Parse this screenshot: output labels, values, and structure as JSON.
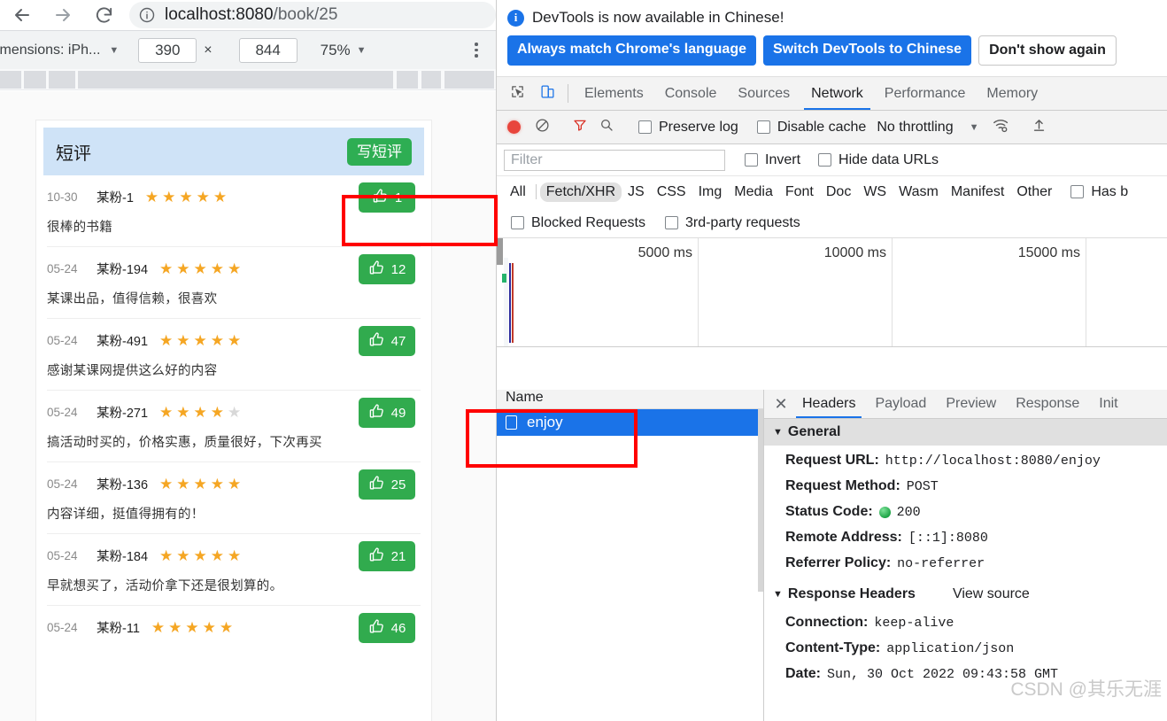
{
  "browser": {
    "back_label": "back-arrow",
    "forward_label": "forward-arrow",
    "reload_label": "reload",
    "site_info_label": "site-information",
    "url_host": "localhost:8080",
    "url_path": "/book/25"
  },
  "device_toolbar": {
    "device_label": "imensions: iPh...",
    "width": "390",
    "times": "×",
    "height": "844",
    "zoom": "75%",
    "caret": "▼",
    "more_label": "more-options"
  },
  "page": {
    "section_title": "短评",
    "write_button": "写短评",
    "comments": [
      {
        "date": "10-30",
        "user": "某粉-1",
        "stars": 5,
        "text": "很棒的书籍",
        "likes": "1"
      },
      {
        "date": "05-24",
        "user": "某粉-194",
        "stars": 5,
        "text": "某课出品，值得信赖，很喜欢",
        "likes": "12"
      },
      {
        "date": "05-24",
        "user": "某粉-491",
        "stars": 5,
        "text": "感谢某课网提供这么好的内容",
        "likes": "47"
      },
      {
        "date": "05-24",
        "user": "某粉-271",
        "stars": 4,
        "text": "搞活动时买的，价格实惠，质量很好，下次再买",
        "likes": "49"
      },
      {
        "date": "05-24",
        "user": "某粉-136",
        "stars": 5,
        "text": "内容详细，挺值得拥有的！",
        "likes": "25"
      },
      {
        "date": "05-24",
        "user": "某粉-184",
        "stars": 5,
        "text": "早就想买了，活动价拿下还是很划算的。",
        "likes": "21"
      },
      {
        "date": "05-24",
        "user": "某粉-11",
        "stars": 5,
        "text": "",
        "likes": "46"
      }
    ],
    "star_on": "★",
    "star_off": "★",
    "thumb_icon": "👍"
  },
  "devtools": {
    "banner": {
      "message": "DevTools is now available in Chinese!",
      "btn_always": "Always match Chrome's language",
      "btn_switch": "Switch DevTools to Chinese",
      "btn_dismiss": "Don't show again"
    },
    "panel_tabs": [
      "Elements",
      "Console",
      "Sources",
      "Network",
      "Performance",
      "Memory"
    ],
    "selected_panel": "Network",
    "toolbar": {
      "record_label": "record",
      "clear_label": "clear",
      "filter_label": "filter",
      "search_label": "search",
      "preserve_log": "Preserve log",
      "disable_cache": "Disable cache",
      "throttling": "No throttling",
      "caret": "▼",
      "wifi_label": "network-conditions",
      "import_label": "import-har"
    },
    "filterbar": {
      "placeholder": "Filter",
      "invert": "Invert",
      "hide_data_urls": "Hide data URLs"
    },
    "types": [
      "All",
      "Fetch/XHR",
      "JS",
      "CSS",
      "Img",
      "Media",
      "Font",
      "Doc",
      "WS",
      "Wasm",
      "Manifest",
      "Other"
    ],
    "selected_type": "Fetch/XHR",
    "has_blocked": "Has b",
    "blocked_requests": "Blocked Requests",
    "third_party": "3rd-party requests",
    "overview": {
      "ticks": [
        "5000 ms",
        "10000 ms",
        "15000 ms"
      ]
    },
    "requests": {
      "column_name": "Name",
      "rows": [
        {
          "name": "enjoy"
        }
      ]
    },
    "detail": {
      "close": "✕",
      "tabs": [
        "Headers",
        "Payload",
        "Preview",
        "Response",
        "Init"
      ],
      "selected_tab": "Headers",
      "general_title": "General",
      "general": [
        {
          "key": "Request URL:",
          "value": "http://localhost:8080/enjoy"
        },
        {
          "key": "Request Method:",
          "value": "POST"
        },
        {
          "key": "Status Code:",
          "value": "200",
          "status_dot": true
        },
        {
          "key": "Remote Address:",
          "value": "[::1]:8080"
        },
        {
          "key": "Referrer Policy:",
          "value": "no-referrer"
        }
      ],
      "response_title": "Response Headers",
      "view_source": "View source",
      "response": [
        {
          "key": "Connection:",
          "value": "keep-alive"
        },
        {
          "key": "Content-Type:",
          "value": "application/json"
        },
        {
          "key": "Date:",
          "value": "Sun, 30 Oct 2022 09:43:58 GMT"
        }
      ]
    }
  },
  "watermark": "CSDN @其乐无涯",
  "colors": {
    "accent_blue": "#1a73e8",
    "green_button": "#31ab4e",
    "star_gold": "#f5a623",
    "header_blue": "#cfe3f7",
    "annotation_red": "#ff0000"
  }
}
